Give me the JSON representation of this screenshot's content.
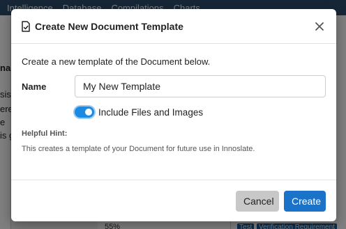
{
  "background": {
    "nav_items": [
      "Intelligence",
      "Database",
      "Compilations",
      "Charts"
    ],
    "left_fragments": [
      "na",
      "sis",
      "ere",
      "e",
      "is g"
    ],
    "percent": "55%",
    "tags": [
      "Test",
      "Verification Requirement"
    ]
  },
  "modal": {
    "icon": "document-check-icon",
    "title": "Create New Document Template",
    "close_icon": "close-icon",
    "intro": "Create a new template of the Document below.",
    "name_label": "Name",
    "name_value": "My New Template",
    "toggle_label": "Include Files and Images",
    "toggle_on": true,
    "hint_title": "Helpful Hint:",
    "hint_text": "This creates a template of your Document for future use in Innoslate.",
    "cancel_label": "Cancel",
    "create_label": "Create"
  },
  "colors": {
    "primary": "#1a73c8",
    "toggle": "#1b8ae3",
    "cancel": "#c8c8c8"
  }
}
